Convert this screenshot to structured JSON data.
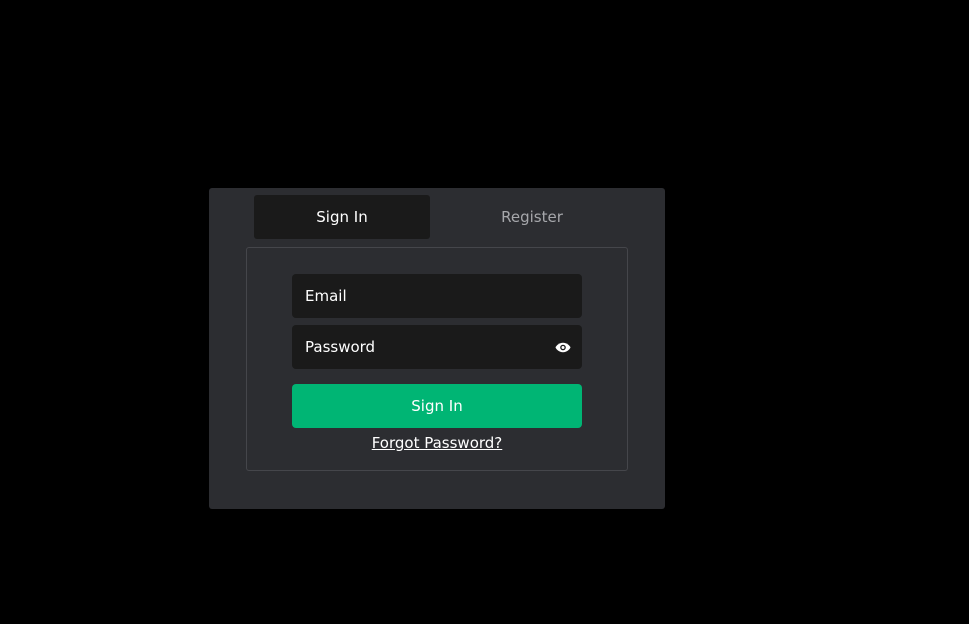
{
  "tabs": {
    "sign_in": "Sign In",
    "register": "Register"
  },
  "form": {
    "email_placeholder": "Email",
    "password_placeholder": "Password",
    "submit_label": "Sign In",
    "forgot_password": "Forgot Password?",
    "password_toggle_icon": "eye-icon"
  },
  "colors": {
    "background": "#000000",
    "card": "#2c2d31",
    "field": "#1a1a1a",
    "accent": "#00b574",
    "inactive_tab_text": "#a6a7ab"
  }
}
